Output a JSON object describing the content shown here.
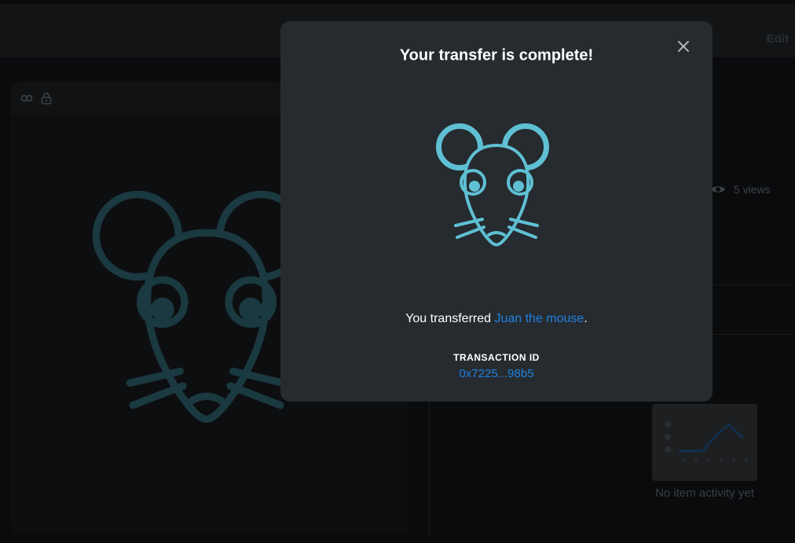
{
  "background": {
    "edit_label": "Edit",
    "views_label": "5 views",
    "activity_empty": "No item activity yet"
  },
  "modal": {
    "title": "Your transfer is complete!",
    "message_prefix": "You transferred ",
    "item_name": "Juan the mouse",
    "message_suffix": ".",
    "transaction_label": "TRANSACTION ID",
    "transaction_id": "0x7225...98b5"
  },
  "colors": {
    "accent_link": "#2081e2",
    "mouse_outline": "#5fc0d4",
    "modal_bg": "#262b2f"
  },
  "icons": [
    "link-icon",
    "lock-icon",
    "eye-icon",
    "close-icon",
    "mouse-logo"
  ]
}
